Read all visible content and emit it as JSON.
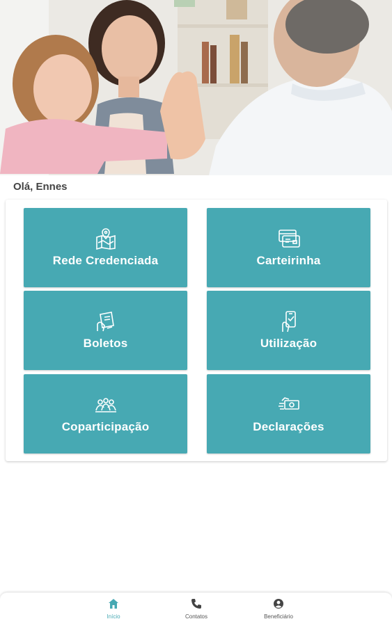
{
  "greeting": "Olá, Ennes",
  "colors": {
    "tile": "#47a9b3",
    "active_nav": "#47a9b3",
    "inactive_nav": "#444444"
  },
  "hero": {
    "image": "photo-of-mother-daughter-doctor-high-five"
  },
  "menu": {
    "tiles": [
      {
        "label": "Rede Credenciada",
        "icon": "map-icon"
      },
      {
        "label": "Carteirinha",
        "icon": "card-icon"
      },
      {
        "label": "Boletos",
        "icon": "payment-icon"
      },
      {
        "label": "Utilização",
        "icon": "phone-hand-icon"
      },
      {
        "label": "Coparticipação",
        "icon": "people-icon"
      },
      {
        "label": "Declarações",
        "icon": "money-hand-icon"
      }
    ]
  },
  "nav": {
    "items": [
      {
        "label": "Início",
        "icon": "home-icon",
        "active": true
      },
      {
        "label": "Contatos",
        "icon": "phone-icon",
        "active": false
      },
      {
        "label": "Beneficiário",
        "icon": "user-icon",
        "active": false
      }
    ]
  }
}
